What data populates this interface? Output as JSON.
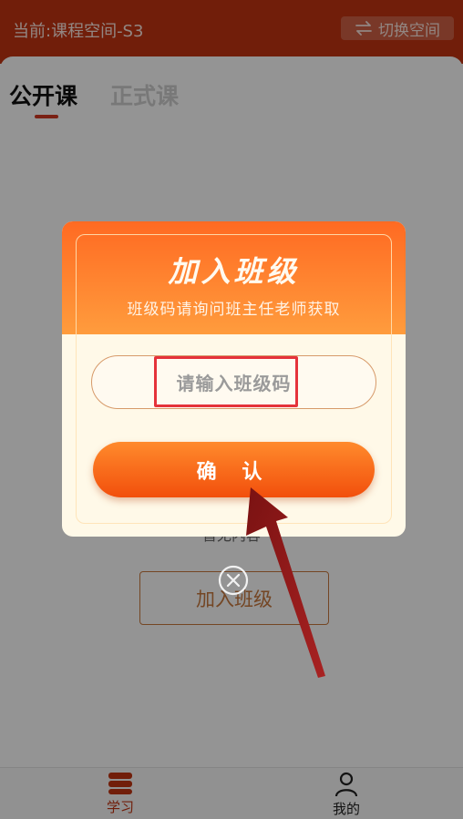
{
  "header": {
    "space_label": "当前:课程空间-S3",
    "switch_label": "切换空间"
  },
  "tabs": [
    {
      "label": "公开课",
      "active": true
    },
    {
      "label": "正式课",
      "active": false
    }
  ],
  "background": {
    "behind_text": "暂无内容",
    "join_button": "加入班级"
  },
  "dialog": {
    "title": "加入班级",
    "subtitle": "班级码请询问班主任老师获取",
    "input_placeholder": "请输入班级码",
    "confirm_label": "确 认"
  },
  "bottom_nav": [
    {
      "label": "学习",
      "icon": "book-stack-icon",
      "active": true
    },
    {
      "label": "我的",
      "icon": "person-icon",
      "active": false
    }
  ],
  "colors": {
    "header": "#c33512",
    "dialog_top": "#ff6a22",
    "confirm": "#f24f0c",
    "highlight": "#e5323a",
    "arrow": "#8a1a1a"
  }
}
